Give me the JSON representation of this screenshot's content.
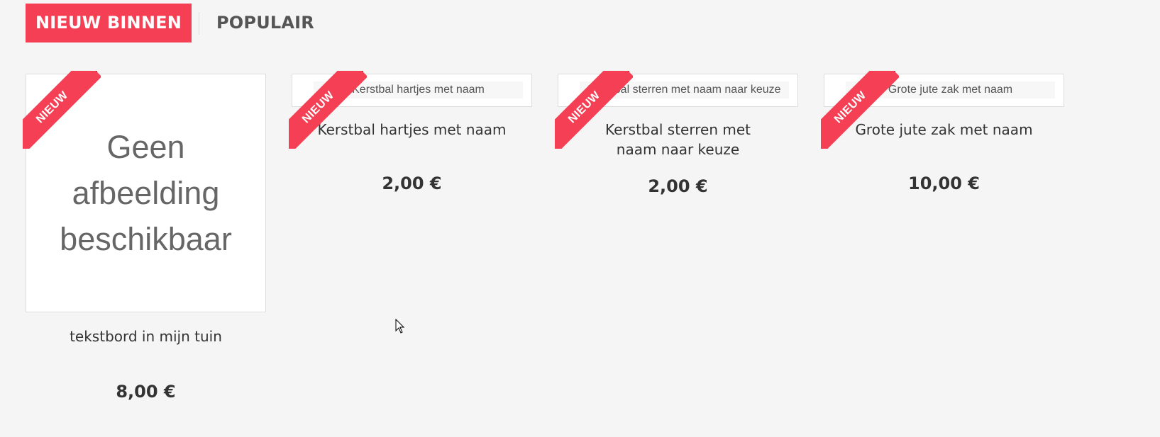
{
  "tabs": [
    {
      "label": "NIEUW BINNEN",
      "active": true
    },
    {
      "label": "POPULAIR",
      "active": false
    }
  ],
  "products": [
    {
      "badge": "NIEUW",
      "image_text": "Geen afbeelding beschikbaar",
      "title": "tekstbord in mijn tuin",
      "price": "8,00 €"
    },
    {
      "badge": "NIEUW",
      "image_alt": "Kerstbal hartjes met naam",
      "title": "Kerstbal hartjes met naam",
      "price": "2,00 €"
    },
    {
      "badge": "NIEUW",
      "image_alt": "Kerstbal sterren met naam naar keuze",
      "title": "Kerstbal sterren met naam naar keuze",
      "price": "2,00 €"
    },
    {
      "badge": "NIEUW",
      "image_alt": "Grote jute zak met naam",
      "title": "Grote jute zak met naam",
      "price": "10,00 €"
    }
  ],
  "colors": {
    "accent": "#f43f54",
    "background": "#f5f5f5"
  }
}
